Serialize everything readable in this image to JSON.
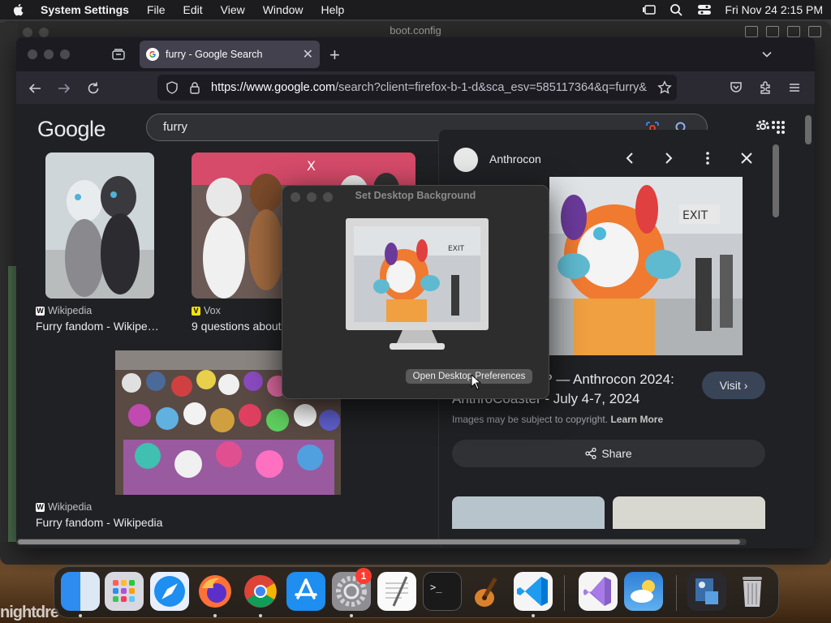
{
  "menubar": {
    "app": "System Settings",
    "items": [
      "File",
      "Edit",
      "View",
      "Window",
      "Help"
    ],
    "clock": "Fri Nov 24  2:15 PM"
  },
  "background_window": {
    "title": "boot.config"
  },
  "browser": {
    "tab_title": "furry - Google Search",
    "url_host": "https://www.google.com",
    "url_rest": "/search?client=firefox-b-1-d&sca_esv=585117364&q=furry&",
    "google": {
      "logo": "Google",
      "query": "furry"
    },
    "results": [
      {
        "source": "Wikipedia",
        "caption": "Furry fandom - Wikipe…"
      },
      {
        "source": "Vox",
        "caption": "9 questions about"
      },
      {
        "source": "Wikipedia",
        "caption": "Furry fandom - Wikipedia"
      }
    ],
    "panel": {
      "site": "Anthrocon",
      "title": "What Is \"Furry\"? — Anthrocon 2024: AnthroCoaster - July 4-7, 2024",
      "visit": "Visit",
      "copyright": "Images may be subject to copyright.",
      "learn_more": "Learn More",
      "share": "Share"
    }
  },
  "dialog": {
    "title": "Set Desktop Background",
    "button": "Open Desktop Preferences"
  },
  "dock": {
    "apps": [
      "Finder",
      "Launchpad",
      "Safari",
      "Firefox",
      "Chrome",
      "App Store",
      "System Settings",
      "TextEdit",
      "Terminal",
      "GarageBand",
      "Visual Studio Code",
      "Visual Studio",
      "Weather",
      "Preview",
      "Trash"
    ],
    "settings_badge": "1"
  },
  "wallpaper_text": "nightdre",
  "colors": {
    "accent": "#8ab4f8",
    "page_bg": "#202124"
  }
}
